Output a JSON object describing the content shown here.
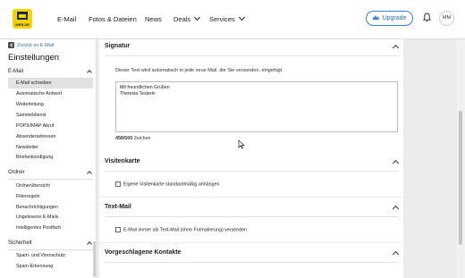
{
  "brand": {
    "logo_text": "WEB.DE",
    "logo_icon": "web-de-logo"
  },
  "topnav": {
    "items": [
      {
        "label": "E-Mail"
      },
      {
        "label": "Fotos & Dateien"
      },
      {
        "label": "News"
      },
      {
        "label": "Deals"
      },
      {
        "label": "Services"
      }
    ],
    "upgrade_label": "Upgrade",
    "avatar_initials": "MM"
  },
  "sidebar": {
    "back_label": "Zurück zu E-Mail",
    "title": "Einstellungen",
    "sections": [
      {
        "heading": "E-Mail",
        "items": [
          "E-Mail schreiben",
          "Automatische Antwort",
          "Weiterleitung",
          "Sammeldienst",
          "POP3/IMAP Abruf",
          "Absenderadressen",
          "Newsletter",
          "Briefankündigung"
        ]
      },
      {
        "heading": "Ordner",
        "items": [
          "Ordnerübersicht",
          "Filterregeln",
          "Benachrichtigungen",
          "Ungelesene E-Mails",
          "Intelligentes Postfach"
        ]
      },
      {
        "heading": "Sicherheit",
        "items": [
          "Spam- und Virenschutz",
          "Spam-Erkennung"
        ]
      }
    ],
    "active_item": "E-Mail schreiben"
  },
  "main": {
    "signature": {
      "title": "Signatur",
      "description": "Dieser Text wird automatisch in jede neue Mail, die Sie versenden, eingefügt.",
      "text": "Mit freundlichen Grüßen\nTheresia Testerin",
      "count": "458/500",
      "count_suffix": "Zeichen"
    },
    "visitenkarte": {
      "title": "Visitenkarte",
      "checkbox_label": "Eigene Visitenkarte standardmäßig anhängen",
      "checked": false
    },
    "textmail": {
      "title": "Text-Mail",
      "checkbox_label": "E-Mail immer als Text-Mail (ohne Formatierung) versenden",
      "checked": false
    },
    "kontakte": {
      "title": "Vorgeschlagene Kontakte"
    }
  },
  "colors": {
    "accent": "#2f6fc0",
    "logo_bg": "#f5d400",
    "logo_fg": "#1c2a4a"
  }
}
